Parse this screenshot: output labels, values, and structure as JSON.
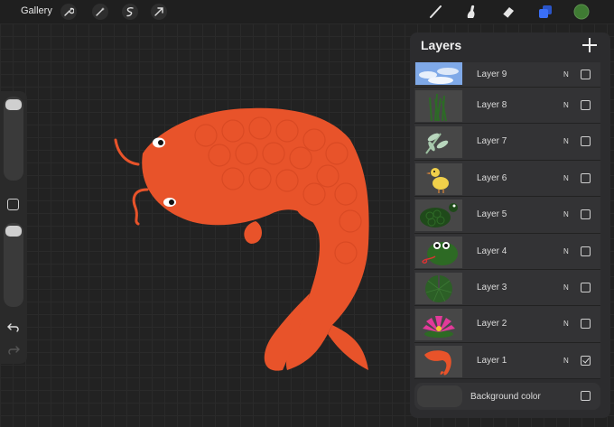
{
  "toolbar": {
    "gallery_label": "Gallery",
    "left_tools": [
      "wrench-icon",
      "magic-wand-icon",
      "selection-icon",
      "transform-arrow-icon"
    ],
    "right_tools": [
      "brush-icon",
      "smudge-icon",
      "eraser-icon",
      "layers-icon",
      "color-swatch"
    ],
    "active_color": "#3f7b33",
    "layers_icon_color": "#3a6ff7"
  },
  "sidebar": {
    "brush_size_slider": "brush-size",
    "opacity_slider": "opacity",
    "modify_button": "modify"
  },
  "layers_panel": {
    "title": "Layers",
    "layers": [
      {
        "name": "Layer 9",
        "blend": "N",
        "visible": false,
        "thumb": "sky"
      },
      {
        "name": "Layer 8",
        "blend": "N",
        "visible": false,
        "thumb": "grass"
      },
      {
        "name": "Layer 7",
        "blend": "N",
        "visible": false,
        "thumb": "dragonfly"
      },
      {
        "name": "Layer 6",
        "blend": "N",
        "visible": false,
        "thumb": "duck"
      },
      {
        "name": "Layer 5",
        "blend": "N",
        "visible": false,
        "thumb": "turtle"
      },
      {
        "name": "Layer 4",
        "blend": "N",
        "visible": false,
        "thumb": "frog"
      },
      {
        "name": "Layer 3",
        "blend": "N",
        "visible": false,
        "thumb": "lilypad"
      },
      {
        "name": "Layer 2",
        "blend": "N",
        "visible": false,
        "thumb": "lotus"
      },
      {
        "name": "Layer 1",
        "blend": "N",
        "visible": true,
        "thumb": "koi"
      }
    ],
    "background": {
      "label": "Background color",
      "visible": false
    }
  },
  "canvas": {
    "fish_color": "#e8532a"
  }
}
